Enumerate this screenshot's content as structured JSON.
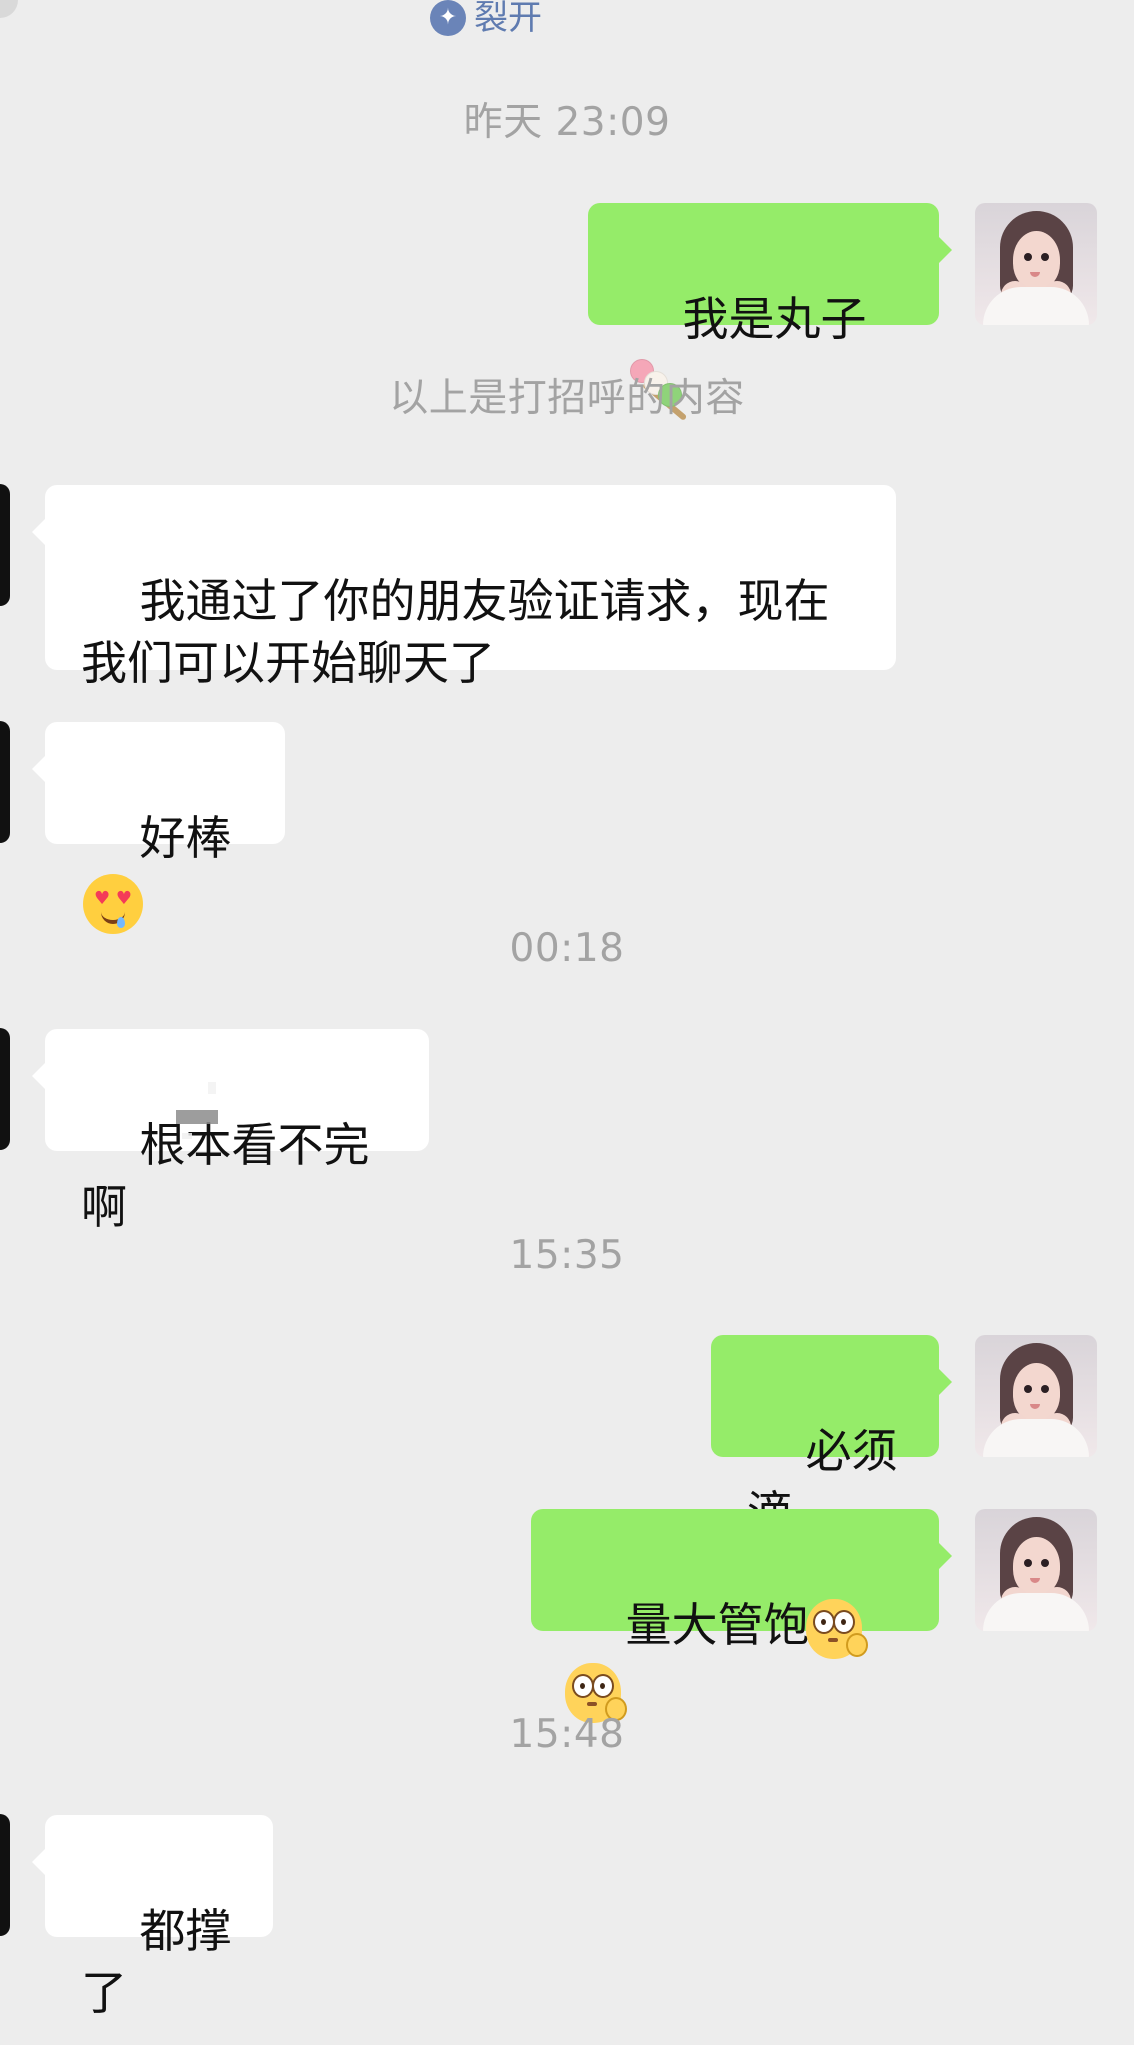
{
  "header": {
    "tag_text": "裂开",
    "tag_icon": "spark-icon"
  },
  "timestamps": {
    "t1": "昨天 23:09",
    "t2": "00:18",
    "t3": "15:35",
    "t4": "15:48"
  },
  "system": {
    "greeting_boundary": "以上是打招呼的内容"
  },
  "messages": [
    {
      "side": "right",
      "text": "我是丸子",
      "emoji": "dango-emoji"
    },
    {
      "side": "left",
      "text": "我通过了你的朋友验证请求，现在\n我们可以开始聊天了"
    },
    {
      "side": "left",
      "text": "好棒",
      "emoji": "heart-eyes-drool-emoji"
    },
    {
      "side": "left",
      "text": "根本看不完啊"
    },
    {
      "side": "right",
      "text": "必须滴"
    },
    {
      "side": "right",
      "text": "量大管饱",
      "emoji": "shy-face-emoji"
    },
    {
      "side": "left",
      "text": "都撑了"
    }
  ],
  "colors": {
    "background": "#ededed",
    "self_bubble": "#95ec69",
    "other_bubble": "#ffffff",
    "system_text": "#a3a3a3",
    "tag_text": "#5f7bb0"
  }
}
